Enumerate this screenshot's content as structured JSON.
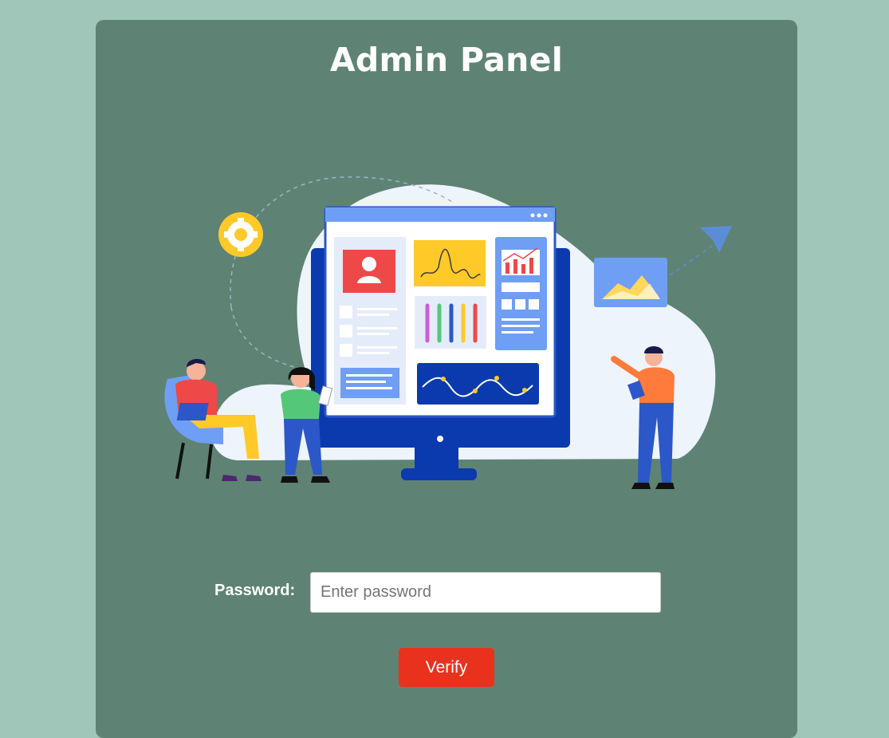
{
  "header": {
    "title": "Admin Panel"
  },
  "illustration": {
    "name": "dashboard-team-illustration"
  },
  "form": {
    "password_label": "Password:",
    "password_placeholder": "Enter password",
    "password_value": "",
    "verify_label": "Verify"
  },
  "colors": {
    "page_background": "#9fc6b8",
    "panel_background": "#5e8374",
    "button": "#e8321e"
  }
}
